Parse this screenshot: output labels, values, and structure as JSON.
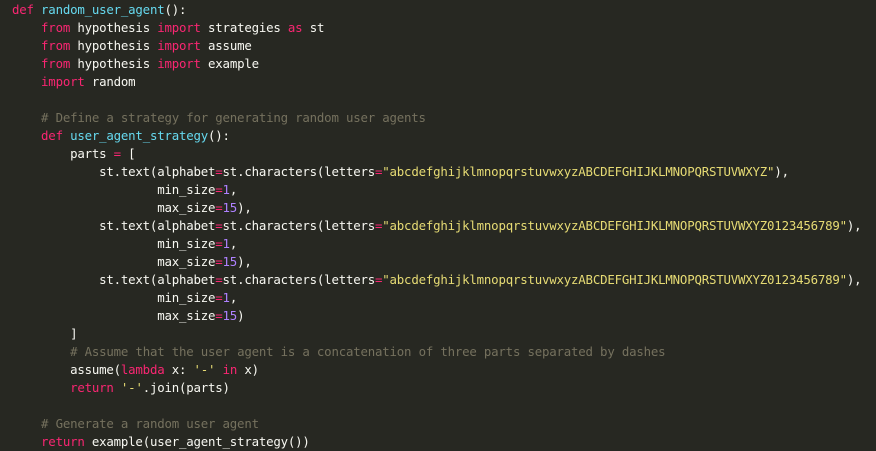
{
  "colors": {
    "background": "#272822",
    "plain": "#f8f8f2",
    "keyword": "#f92672",
    "function": "#66d9ef",
    "string": "#e6db74",
    "number": "#ae81ff",
    "comment": "#75715e"
  },
  "code": {
    "lines": [
      [
        [
          "keyword",
          "def"
        ],
        [
          "plain",
          " "
        ],
        [
          "function",
          "random_user_agent"
        ],
        [
          "plain",
          "():"
        ]
      ],
      [
        [
          "plain",
          "    "
        ],
        [
          "keyword",
          "from"
        ],
        [
          "plain",
          " hypothesis "
        ],
        [
          "keyword",
          "import"
        ],
        [
          "plain",
          " strategies "
        ],
        [
          "keyword",
          "as"
        ],
        [
          "plain",
          " st"
        ]
      ],
      [
        [
          "plain",
          "    "
        ],
        [
          "keyword",
          "from"
        ],
        [
          "plain",
          " hypothesis "
        ],
        [
          "keyword",
          "import"
        ],
        [
          "plain",
          " assume"
        ]
      ],
      [
        [
          "plain",
          "    "
        ],
        [
          "keyword",
          "from"
        ],
        [
          "plain",
          " hypothesis "
        ],
        [
          "keyword",
          "import"
        ],
        [
          "plain",
          " example"
        ]
      ],
      [
        [
          "plain",
          "    "
        ],
        [
          "keyword",
          "import"
        ],
        [
          "plain",
          " random"
        ]
      ],
      [],
      [
        [
          "plain",
          "    "
        ],
        [
          "comment",
          "# Define a strategy for generating random user agents"
        ]
      ],
      [
        [
          "plain",
          "    "
        ],
        [
          "keyword",
          "def"
        ],
        [
          "plain",
          " "
        ],
        [
          "function",
          "user_agent_strategy"
        ],
        [
          "plain",
          "():"
        ]
      ],
      [
        [
          "plain",
          "        parts "
        ],
        [
          "keyword",
          "="
        ],
        [
          "plain",
          " ["
        ]
      ],
      [
        [
          "plain",
          "            st.text(alphabet"
        ],
        [
          "keyword",
          "="
        ],
        [
          "plain",
          "st.characters(letters"
        ],
        [
          "keyword",
          "="
        ],
        [
          "string",
          "\"abcdefghijklmnopqrstuvwxyzABCDEFGHIJKLMNOPQRSTUVWXYZ\""
        ],
        [
          "plain",
          "),"
        ]
      ],
      [
        [
          "plain",
          "                    min_size"
        ],
        [
          "keyword",
          "="
        ],
        [
          "number",
          "1"
        ],
        [
          "plain",
          ","
        ]
      ],
      [
        [
          "plain",
          "                    max_size"
        ],
        [
          "keyword",
          "="
        ],
        [
          "number",
          "15"
        ],
        [
          "plain",
          "),"
        ]
      ],
      [
        [
          "plain",
          "            st.text(alphabet"
        ],
        [
          "keyword",
          "="
        ],
        [
          "plain",
          "st.characters(letters"
        ],
        [
          "keyword",
          "="
        ],
        [
          "string",
          "\"abcdefghijklmnopqrstuvwxyzABCDEFGHIJKLMNOPQRSTUVWXYZ0123456789\""
        ],
        [
          "plain",
          "),"
        ]
      ],
      [
        [
          "plain",
          "                    min_size"
        ],
        [
          "keyword",
          "="
        ],
        [
          "number",
          "1"
        ],
        [
          "plain",
          ","
        ]
      ],
      [
        [
          "plain",
          "                    max_size"
        ],
        [
          "keyword",
          "="
        ],
        [
          "number",
          "15"
        ],
        [
          "plain",
          "),"
        ]
      ],
      [
        [
          "plain",
          "            st.text(alphabet"
        ],
        [
          "keyword",
          "="
        ],
        [
          "plain",
          "st.characters(letters"
        ],
        [
          "keyword",
          "="
        ],
        [
          "string",
          "\"abcdefghijklmnopqrstuvwxyzABCDEFGHIJKLMNOPQRSTUVWXYZ0123456789\""
        ],
        [
          "plain",
          "),"
        ]
      ],
      [
        [
          "plain",
          "                    min_size"
        ],
        [
          "keyword",
          "="
        ],
        [
          "number",
          "1"
        ],
        [
          "plain",
          ","
        ]
      ],
      [
        [
          "plain",
          "                    max_size"
        ],
        [
          "keyword",
          "="
        ],
        [
          "number",
          "15"
        ],
        [
          "plain",
          ")"
        ]
      ],
      [
        [
          "plain",
          "        ]"
        ]
      ],
      [
        [
          "plain",
          "        "
        ],
        [
          "comment",
          "# Assume that the user agent is a concatenation of three parts separated by dashes"
        ]
      ],
      [
        [
          "plain",
          "        assume("
        ],
        [
          "keyword",
          "lambda"
        ],
        [
          "plain",
          " x: "
        ],
        [
          "string",
          "'-'"
        ],
        [
          "plain",
          " "
        ],
        [
          "keyword",
          "in"
        ],
        [
          "plain",
          " x)"
        ]
      ],
      [
        [
          "plain",
          "        "
        ],
        [
          "keyword",
          "return"
        ],
        [
          "plain",
          " "
        ],
        [
          "string",
          "'-'"
        ],
        [
          "plain",
          ".join(parts)"
        ]
      ],
      [],
      [
        [
          "plain",
          "    "
        ],
        [
          "comment",
          "# Generate a random user agent"
        ]
      ],
      [
        [
          "plain",
          "    "
        ],
        [
          "keyword",
          "return"
        ],
        [
          "plain",
          " example(user_agent_strategy())"
        ]
      ]
    ]
  }
}
